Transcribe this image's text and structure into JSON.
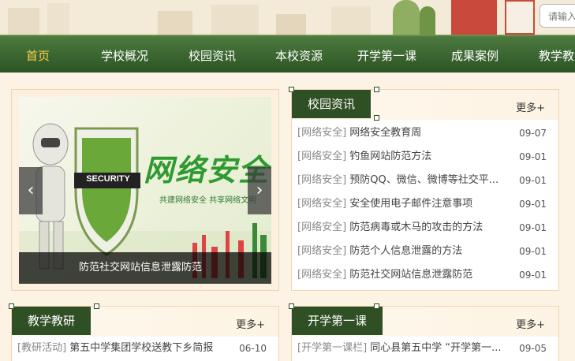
{
  "header": {
    "search_placeholder": "请输入"
  },
  "nav": {
    "items": [
      "首页",
      "学校概况",
      "校园资讯",
      "本校资源",
      "开学第一课",
      "成果案例",
      "教学教"
    ]
  },
  "slider": {
    "caption": "防范社交网站信息泄露防范",
    "prev": "‹",
    "next": "›",
    "banner_title": "网络安全",
    "banner_sub": "共建网络安全 共享网络文明",
    "shield_text": "SECURITY"
  },
  "news": {
    "title": "校园资讯",
    "more": "更多+",
    "rows": [
      {
        "cat": "[网络安全]",
        "text": "网络安全教育周",
        "date": "09-07"
      },
      {
        "cat": "[网络安全]",
        "text": "钓鱼网站防范方法",
        "date": "09-01"
      },
      {
        "cat": "[网络安全]",
        "text": "预防QQ、微信、微博等社交平...",
        "date": "09-01"
      },
      {
        "cat": "[网络安全]",
        "text": "安全使用电子邮件注意事项",
        "date": "09-01"
      },
      {
        "cat": "[网络安全]",
        "text": "防范病毒或木马的攻击的方法",
        "date": "09-01"
      },
      {
        "cat": "[网络安全]",
        "text": "防范个人信息泄露的方法",
        "date": "09-01"
      },
      {
        "cat": "[网络安全]",
        "text": "防范社交网站信息泄露防范",
        "date": "09-01"
      }
    ]
  },
  "research": {
    "title": "教学教研",
    "more": "更多+",
    "rows": [
      {
        "cat": "[教研活动]",
        "text": "第五中学集团学校送教下乡简报",
        "date": "06-10"
      }
    ]
  },
  "firstclass": {
    "title": "开学第一课",
    "more": "更多+",
    "rows": [
      {
        "cat": "[开学第一课栏]",
        "text": "同心县第五中学 “开学第一...",
        "date": "09-05"
      }
    ]
  }
}
